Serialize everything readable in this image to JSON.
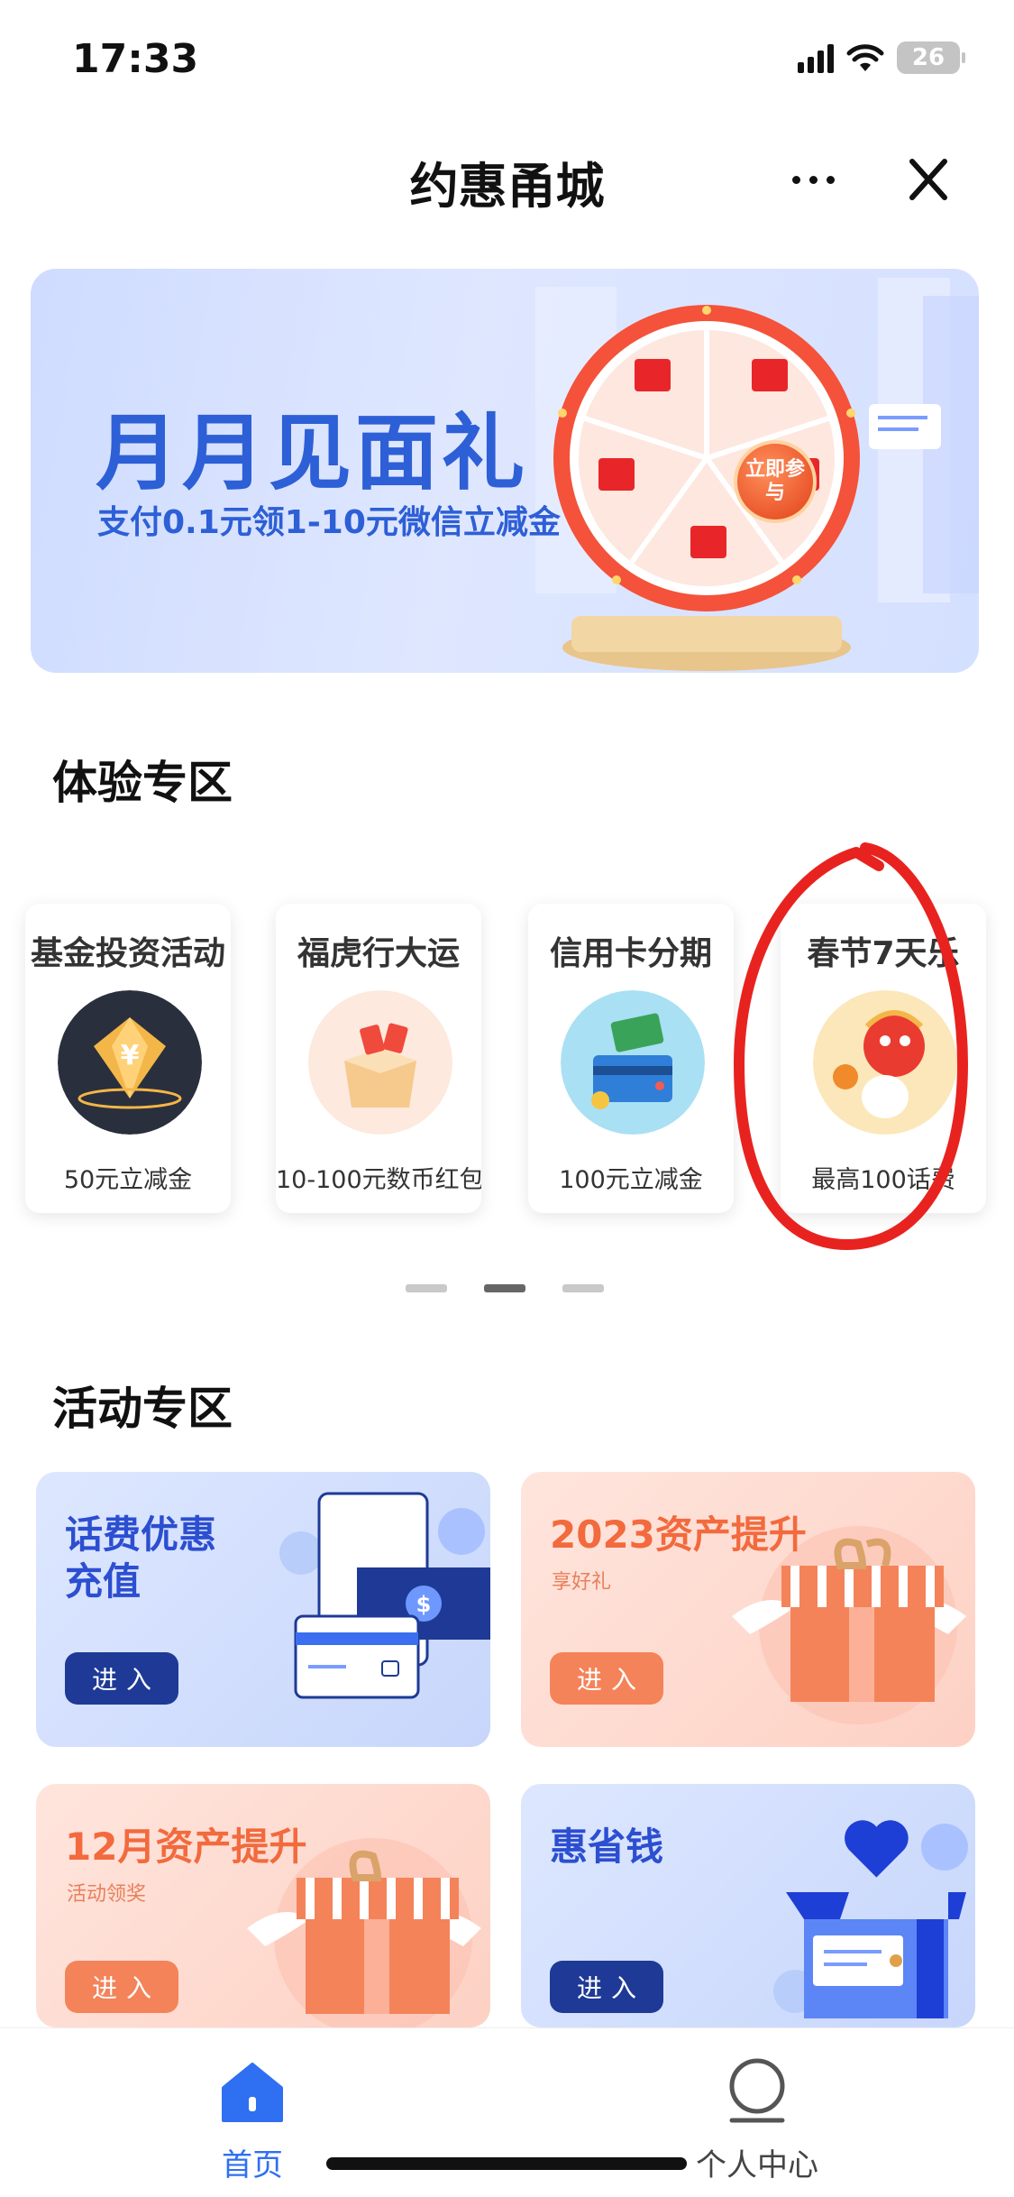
{
  "status": {
    "time": "17:33",
    "battery": "26"
  },
  "header": {
    "title": "约惠甬城"
  },
  "hero": {
    "title": "月月见面礼",
    "subtitle": "支付0.1元领1-10元微信立减金",
    "wheel_center": "立即参与"
  },
  "experience": {
    "heading": "体验专区",
    "cards": [
      {
        "title": "基金投资活动",
        "desc": "50元立减金"
      },
      {
        "title": "福虎行大运",
        "desc": "10-100元数币红包"
      },
      {
        "title": "信用卡分期",
        "desc": "100元立减金"
      },
      {
        "title": "春节7天乐",
        "desc": "最高100话费"
      }
    ],
    "pager": {
      "count": 3,
      "active_index": 1
    }
  },
  "activities": {
    "heading": "活动专区",
    "cards": [
      {
        "title_line1": "话费优惠",
        "title_line2": "充值",
        "subtitle": "",
        "button": "进入",
        "theme": "blue"
      },
      {
        "title_line1": "2023资产提升",
        "title_line2": "",
        "subtitle": "享好礼",
        "button": "进入",
        "theme": "orange"
      },
      {
        "title_line1": "12月资产提升",
        "title_line2": "",
        "subtitle": "活动领奖",
        "button": "进入",
        "theme": "orange"
      },
      {
        "title_line1": "惠省钱",
        "title_line2": "",
        "subtitle": "",
        "button": "进入",
        "theme": "blue"
      }
    ]
  },
  "tabbar": {
    "home_label": "首页",
    "me_label": "个人中心"
  },
  "colors": {
    "accent_blue": "#2f6ff2",
    "hero_blue": "#2d5fd6",
    "orange": "#f26a3d",
    "annotation_red": "#e8231f"
  }
}
